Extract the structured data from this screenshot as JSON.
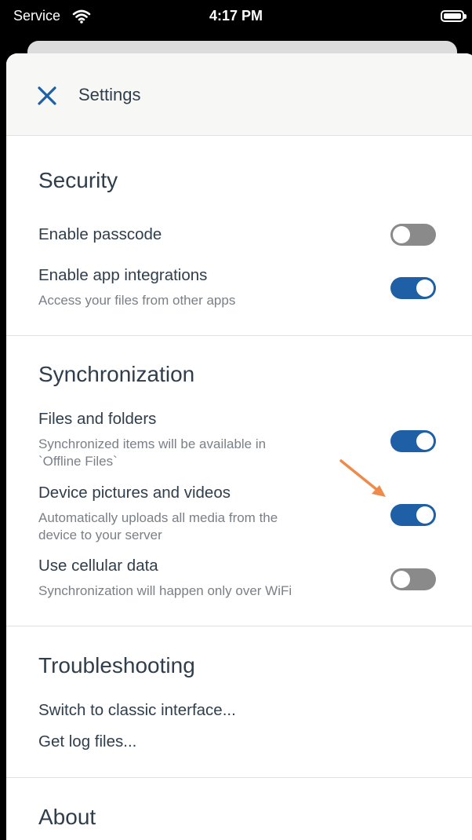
{
  "status_bar": {
    "carrier": "Service",
    "time": "4:17 PM"
  },
  "header": {
    "title": "Settings"
  },
  "security": {
    "title": "Security",
    "rows": [
      {
        "label": "Enable passcode",
        "subtitle": "",
        "enabled": false
      },
      {
        "label": "Enable app integrations",
        "subtitle": "Access your files from other apps",
        "enabled": true
      }
    ]
  },
  "synchronization": {
    "title": "Synchronization",
    "rows": [
      {
        "label": "Files and folders",
        "subtitle_lines": [
          "Synchronized items will be available in",
          "`Offline Files`"
        ],
        "enabled": true
      },
      {
        "label": "Device pictures and videos",
        "subtitle_lines": [
          "Automatically uploads all media from the",
          "device to your server"
        ],
        "enabled": true
      },
      {
        "label": "Use cellular data",
        "subtitle_lines": [
          "Synchronization will happen only over WiFi"
        ],
        "enabled": false
      }
    ]
  },
  "troubleshooting": {
    "title": "Troubleshooting",
    "items": [
      "Switch to classic interface...",
      "Get log files..."
    ]
  },
  "about": {
    "title": "About"
  },
  "colors": {
    "accent": "#1e5fa6",
    "toggle_off": "#8a8a8a",
    "annotation_arrow": "#f08a4b",
    "text": "#2f3e4c"
  }
}
